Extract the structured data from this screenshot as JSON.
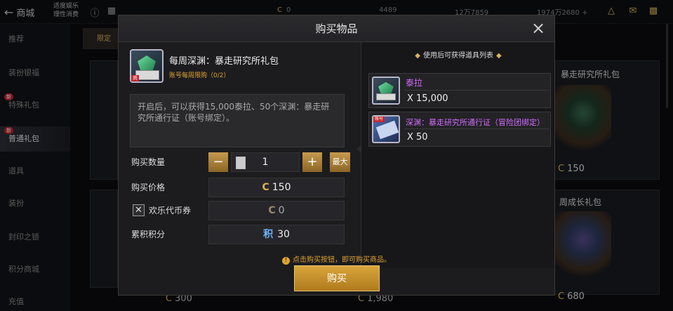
{
  "topbar": {
    "back_label": "商城",
    "small_text_1": "适度娱乐",
    "small_text_2": "理性消费",
    "currencies": [
      "0",
      "4489",
      "12万7859",
      "1974万2680"
    ]
  },
  "sidebar": {
    "items": [
      {
        "label": "推荐",
        "active": false,
        "badge": ""
      },
      {
        "label": "装扮银福",
        "active": false,
        "badge": ""
      },
      {
        "label": "特殊礼包",
        "active": false,
        "badge": "新"
      },
      {
        "label": "普通礼包",
        "active": true,
        "badge": "新"
      },
      {
        "label": "道具",
        "active": false,
        "badge": ""
      },
      {
        "label": "装扮",
        "active": false,
        "badge": ""
      },
      {
        "label": "封印之锁",
        "active": false,
        "badge": ""
      },
      {
        "label": "积分商城",
        "active": false,
        "badge": ""
      },
      {
        "label": "充值",
        "active": false,
        "badge": ""
      }
    ]
  },
  "background_cards": {
    "tab_label": "限定",
    "card_title_1": "暴走研究所礼包",
    "card_price_1": "150",
    "card_title_2": "周成长礼包",
    "card_price_2": "680",
    "bottom_prices": [
      "300",
      "1,980"
    ]
  },
  "modal": {
    "title": "购买物品",
    "item_name": "每周深渊：暴走研究所礼包",
    "item_tag": "尚",
    "limit_text": "账号每周限购（0/2）",
    "description": "开启后，可以获得15,000泰拉、50个深渊：暴走研究所通行证（账号绑定）。",
    "quantity_label": "购买数量",
    "quantity_value": "1",
    "max_label": "最大",
    "price_label": "购买价格",
    "price_value": "150",
    "coupon_label": "欢乐代币券",
    "coupon_value": "0",
    "points_label": "累积积分",
    "points_icon_text": "积",
    "points_value": "30",
    "hint_text": "点击购买按钮，即可购买商品。",
    "buy_label": "购买",
    "rewards_title": "使用后可获得道具列表",
    "rewards": [
      {
        "name": "泰拉",
        "qty": "X 15,000",
        "icon": "tera-chest-icon"
      },
      {
        "name": "深渊：暴走研究所通行证（冒险团绑定）",
        "qty": "X 50",
        "icon": "pass-ticket-icon",
        "tag": "账号"
      }
    ]
  }
}
